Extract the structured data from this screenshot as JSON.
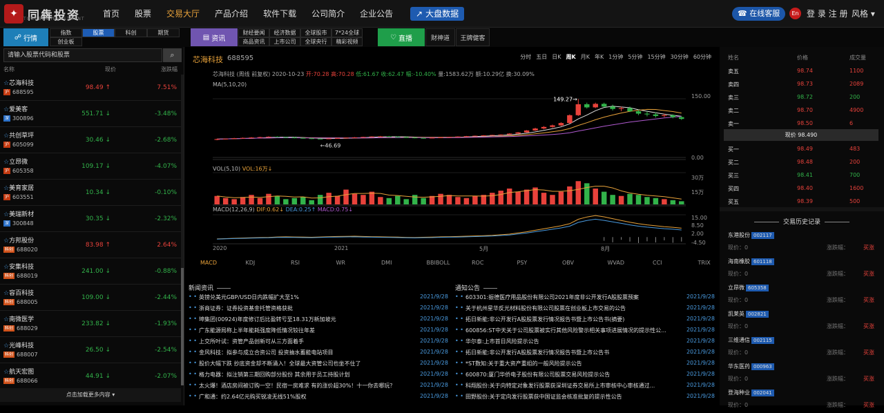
{
  "header": {
    "logo_text": "同犇投资",
    "logo_sub": "TONGBEN INVESTMENT",
    "nav": [
      "首页",
      "股票",
      "交易大厅",
      "产品介绍",
      "软件下载",
      "公司简介",
      "企业公告"
    ],
    "active_nav": "交易大厅",
    "bigdata_label": "大盘数据",
    "service_label": "在线客服",
    "lang": "En",
    "login": "登 录",
    "register": "注 册",
    "style": "风格"
  },
  "subbar": {
    "market_label": "行情",
    "market_tabs": [
      "指数",
      "股票",
      "科创",
      "期货",
      "创业板"
    ],
    "active_market": "股票",
    "news_label": "资讯",
    "news_tabs": [
      "财经要闻",
      "经济数据",
      "全球股市",
      "7*24全球",
      "商品资讯",
      "上市公司",
      "全球央行",
      "精彩视频"
    ],
    "live_label": "直播",
    "live_tabs": [
      "财神道",
      "王牌健客"
    ]
  },
  "left": {
    "search_placeholder": "请输入股票代码和股票",
    "cols": [
      "名称",
      "现价",
      "涨跌幅"
    ],
    "load_more": "点击加载更多内容",
    "stocks": [
      {
        "name": "芯海科技",
        "mk": "沪",
        "mkc": "hu",
        "code": "688595",
        "price": "98.49 ↑",
        "chg": "7.51%",
        "dir": "up"
      },
      {
        "name": "爱美客",
        "mk": "深",
        "mkc": "shen",
        "code": "300896",
        "price": "551.71 ↓",
        "chg": "-3.48%",
        "dir": "down"
      },
      {
        "name": "共创草坪",
        "mk": "沪",
        "mkc": "hu",
        "code": "605099",
        "price": "30.46 ↓",
        "chg": "-2.68%",
        "dir": "down"
      },
      {
        "name": "立昂微",
        "mk": "沪",
        "mkc": "hu",
        "code": "605358",
        "price": "109.17 ↓",
        "chg": "-4.07%",
        "dir": "down"
      },
      {
        "name": "美育家居",
        "mk": "沪",
        "mkc": "hu",
        "code": "603551",
        "price": "10.34 ↓",
        "chg": "-0.10%",
        "dir": "down"
      },
      {
        "name": "美瑞新材",
        "mk": "深",
        "mkc": "shen",
        "code": "300848",
        "price": "30.35 ↓",
        "chg": "-2.32%",
        "dir": "down"
      },
      {
        "name": "方邦股份",
        "mk": "科创",
        "mkc": "kc",
        "code": "688020",
        "price": "83.98 ↑",
        "chg": "2.64%",
        "dir": "up"
      },
      {
        "name": "安集科技",
        "mk": "科创",
        "mkc": "kc",
        "code": "688019",
        "price": "241.00 ↓",
        "chg": "-0.88%",
        "dir": "down"
      },
      {
        "name": "容百科技",
        "mk": "科创",
        "mkc": "kc",
        "code": "688005",
        "price": "109.00 ↓",
        "chg": "-2.44%",
        "dir": "down"
      },
      {
        "name": "南微医学",
        "mk": "科创",
        "mkc": "kc",
        "code": "688029",
        "price": "233.82 ↓",
        "chg": "-1.93%",
        "dir": "down"
      },
      {
        "name": "光峰科技",
        "mk": "科创",
        "mkc": "kc",
        "code": "688007",
        "price": "26.50 ↓",
        "chg": "-2.54%",
        "dir": "down"
      },
      {
        "name": "航天宏图",
        "mk": "科创",
        "mkc": "kc",
        "code": "688066",
        "price": "44.91 ↓",
        "chg": "-2.07%",
        "dir": "down"
      }
    ]
  },
  "chart": {
    "name": "芯海科技",
    "code": "688595",
    "periods": [
      "分时",
      "五日",
      "日K",
      "周K",
      "月K",
      "年K",
      "1分钟",
      "5分钟",
      "15分钟",
      "30分钟",
      "60分钟"
    ],
    "active_period": "周K",
    "info": {
      "base": "芯海科技 (周线 前复权) 2020-10-23",
      "open": "开:70.28",
      "high": "高:70.28",
      "low": "低:61.67",
      "close": "收:62.47",
      "chg": "幅:-10.40%",
      "amt": "量:1583.62万",
      "turn": "额:10.29亿",
      "rate": "换:30.09%"
    },
    "ma_label": "MA(5,10,20)",
    "hi_annot": "149.27→",
    "lo_annot": "←46.69",
    "price_axis": [
      "150.00",
      "0.00"
    ],
    "vol_label": "VOL(5,10)",
    "vol_val": "VOL:16万↓",
    "vol_axis": [
      "30万",
      "15万"
    ],
    "macd_label": "MACD(12,26,9)",
    "dif": "DIF:0.62↓",
    "dea": "DEA:0.25↑",
    "macd_val": "MACD:0.75↓",
    "macd_axis": [
      "15.00",
      "8.50",
      "2.00",
      "-4.50"
    ],
    "x_labels": [
      "2020",
      "2021",
      "5月",
      "8月"
    ],
    "indicators": [
      "MACD",
      "KDJ",
      "RSI",
      "WR",
      "DMI",
      "BBIBOLL",
      "ROC",
      "PSY",
      "OBV",
      "WVAD",
      "CCI",
      "TRIX"
    ],
    "active_indicator": "MACD",
    "ohlc": [
      [
        45,
        48,
        44,
        47
      ],
      [
        47,
        48,
        46,
        48
      ],
      [
        48,
        50,
        47,
        49
      ],
      [
        49,
        51,
        48,
        50
      ],
      [
        50,
        52,
        49,
        51
      ],
      [
        51,
        53,
        50,
        52
      ],
      [
        52,
        54,
        51,
        53
      ],
      [
        53,
        54,
        51,
        52
      ],
      [
        52,
        53,
        50,
        51
      ],
      [
        51,
        52,
        49,
        50
      ],
      [
        50,
        51,
        48,
        49
      ],
      [
        49,
        50,
        47,
        48
      ],
      [
        48,
        49,
        46.69,
        47.5
      ],
      [
        47.5,
        49,
        47,
        48.5
      ],
      [
        48.5,
        50,
        48,
        49.5
      ],
      [
        49.5,
        51,
        49,
        50.5
      ],
      [
        50.5,
        52,
        50,
        51.5
      ],
      [
        51.5,
        53,
        51,
        52.5
      ],
      [
        52.5,
        54,
        52,
        53.5
      ],
      [
        53.5,
        55,
        53,
        54
      ],
      [
        54,
        55,
        52,
        53
      ],
      [
        53,
        54,
        51,
        52
      ],
      [
        52,
        53,
        50,
        51
      ],
      [
        51,
        52,
        49,
        50
      ],
      [
        50,
        51,
        48,
        49.5
      ],
      [
        49.5,
        51,
        49,
        50.5
      ],
      [
        50.5,
        52,
        50,
        51.5
      ],
      [
        51.5,
        53,
        51,
        52.5
      ],
      [
        52.5,
        54,
        52,
        53.5
      ],
      [
        53.5,
        55,
        53,
        54.5
      ],
      [
        54.5,
        56,
        54,
        55.5
      ],
      [
        55.5,
        57,
        55,
        56.5
      ],
      [
        56.5,
        58,
        56,
        57.5
      ],
      [
        57.5,
        59,
        57,
        58.5
      ],
      [
        58.5,
        62,
        58,
        61
      ],
      [
        61,
        65,
        60,
        64
      ],
      [
        64,
        70,
        63,
        69
      ],
      [
        69,
        76,
        68,
        74
      ],
      [
        74,
        80,
        72,
        78
      ],
      [
        78,
        84,
        76,
        82
      ],
      [
        82,
        90,
        80,
        88
      ],
      [
        88,
        110,
        86,
        108
      ],
      [
        108,
        149.27,
        106,
        136
      ],
      [
        136,
        140,
        125,
        128
      ],
      [
        128,
        140,
        126,
        137
      ],
      [
        137,
        140,
        128,
        130
      ],
      [
        130,
        135,
        120,
        124
      ],
      [
        124,
        130,
        118,
        126
      ],
      [
        126,
        130,
        116,
        118
      ],
      [
        118,
        122,
        108,
        112
      ],
      [
        112,
        118,
        105,
        110
      ],
      [
        110,
        115,
        102,
        106
      ],
      [
        106,
        112,
        103,
        108
      ],
      [
        108,
        110,
        100,
        103
      ],
      [
        103,
        106,
        96,
        98.49
      ]
    ],
    "vol": [
      8,
      6,
      5,
      7,
      9,
      6,
      10,
      8,
      5,
      6,
      7,
      4,
      9,
      11,
      8,
      14,
      10,
      9,
      12,
      7,
      6,
      8,
      5,
      9,
      6,
      8,
      10,
      9,
      7,
      6,
      8,
      9,
      11,
      13,
      15,
      12,
      14,
      16,
      11,
      9,
      12,
      17,
      22,
      20,
      15,
      12,
      9,
      8,
      10,
      9,
      7,
      6,
      5,
      4,
      3
    ],
    "macd": [
      -1.2,
      -1.0,
      -0.8,
      -0.6,
      -0.4,
      -0.3,
      -0.2,
      0.1,
      0.2,
      0.1,
      0.0,
      -0.1,
      0.1,
      0.3,
      0.4,
      0.5,
      0.6,
      0.4,
      0.3,
      0.2,
      0.1,
      0.0,
      -0.2,
      -0.3,
      -0.1,
      0.0,
      0.2,
      0.3,
      0.4,
      0.6,
      0.8,
      1.0,
      1.2,
      1.6,
      2.0,
      2.8,
      3.6,
      4.6,
      5.6,
      6.6,
      7.6,
      9.0,
      12.0,
      13.5,
      14.5,
      13.6,
      12.4,
      11.2,
      10.0,
      9.0,
      8.2,
      7.6,
      7.0,
      6.6,
      6.0
    ],
    "macd_hist": [
      0,
      0,
      0,
      0,
      0,
      0,
      0,
      0,
      0,
      0,
      0,
      0,
      0,
      0,
      0,
      0,
      0,
      0,
      0,
      0,
      0,
      0,
      0,
      0,
      0,
      0,
      0,
      0,
      0,
      0,
      0,
      0,
      0,
      0,
      0,
      0,
      0,
      0,
      0,
      0,
      0,
      0,
      0,
      0,
      0,
      -2.5,
      -3.5,
      -1.8,
      -3.0,
      -4.0,
      -2.8,
      -3.6,
      -2.2,
      -3.8,
      -3.0
    ]
  },
  "news": {
    "title": "新闻资讯",
    "items": [
      {
        "t": "英镑兑美元GBP/USD日内跌幅扩大至1%",
        "d": "2021/9/28"
      },
      {
        "t": "浙商证券：证券投资基金托管资格获批",
        "d": "2021/9/28"
      },
      {
        "t": "坤集团(00924)年度修订后比盈转亏至18.31万新加坡元",
        "d": "2021/9/28"
      },
      {
        "t": "广东能源局称上半年能耗强度降低情况较往年差",
        "d": "2021/9/28"
      },
      {
        "t": "上交所叶试：资管产品创新可从三方面着手",
        "d": "2021/9/28"
      },
      {
        "t": "金风科技：拟参与成立合资公司 投资抽水蓄能电站项目",
        "d": "2021/9/28"
      },
      {
        "t": "股价大幅下跌 抄底资金却不断涌入！全球最大资管公司也坐不住了",
        "d": "2021/9/28"
      },
      {
        "t": "格力电器：拟注销第三期回购部分股份 其余用于员工持股计划",
        "d": "2021/9/28"
      },
      {
        "t": "太火爆！酒店房间被订购一空！民宿一房难求 有的涨价超30%！十一你去哪玩？",
        "d": "2021/9/28"
      },
      {
        "t": "广和通：约2.64亿元购买锐凌无线51%股权",
        "d": "2021/9/28"
      }
    ]
  },
  "notice": {
    "title": "通知公告",
    "items": [
      {
        "t": "603301:振德医疗用品股份有限公司2021年度非公开发行A股股票预案",
        "d": "2021/9/28"
      },
      {
        "t": "关于杭州星华反光材料股份有限公司股票在创业板上市交易的公告",
        "d": "2021/9/28"
      },
      {
        "t": "拓日新能:非公开发行A股股票发行情况报告书暨上市公告书(摘要)",
        "d": "2021/9/28"
      },
      {
        "t": "600856:ST中天关于公司股票被实行其他风险警示相关事项进展情况的提示性公...",
        "d": "2021/9/28"
      },
      {
        "t": "华尔泰:上市首日风险提示公告",
        "d": "2021/9/28"
      },
      {
        "t": "拓日新能:非公开发行A股股票发行情况报告书暨上市公告书",
        "d": "2021/9/28"
      },
      {
        "t": "*ST数知:关于重大资产重组的一般风险提示公告",
        "d": "2021/9/28"
      },
      {
        "t": "600870:厦门华侨电子股份有限公司股票交易风险提示公告",
        "d": "2021/9/28"
      },
      {
        "t": "科翔股份:关于向特定对象发行股票获深圳证券交易所上市审核中心审核通过...",
        "d": "2021/9/28"
      },
      {
        "t": "田野股份:关于定向发行股票获中国证监会核准批复的提示性公告",
        "d": "2021/9/28"
      }
    ]
  },
  "orderbook": {
    "cols": [
      "姓名",
      "价格",
      "成交量"
    ],
    "sells": [
      {
        "l": "卖五",
        "p": "98.74",
        "v": "1100"
      },
      {
        "l": "卖四",
        "p": "98.73",
        "v": "2089"
      },
      {
        "l": "卖三",
        "p": "98.72",
        "v": "200"
      },
      {
        "l": "卖二",
        "p": "98.70",
        "v": "4900"
      },
      {
        "l": "卖一",
        "p": "98.50",
        "v": "6"
      }
    ],
    "current": "现价 98.490",
    "buys": [
      {
        "l": "买一",
        "p": "98.49",
        "v": "483"
      },
      {
        "l": "买二",
        "p": "98.48",
        "v": "200"
      },
      {
        "l": "买三",
        "p": "98.41",
        "v": "700"
      },
      {
        "l": "买四",
        "p": "98.40",
        "v": "1600"
      },
      {
        "l": "买五",
        "p": "98.39",
        "v": "500"
      }
    ]
  },
  "history": {
    "title": "交易历史记录",
    "price_label": "现价：0",
    "chg_label": "涨跌幅：",
    "buy_label": "买涨",
    "items": [
      {
        "n": "东港股份",
        "c": "002117"
      },
      {
        "n": "海南橡胶",
        "c": "601118"
      },
      {
        "n": "立昂微",
        "c": "605358"
      },
      {
        "n": "凯莱英",
        "c": "002821"
      },
      {
        "n": "三维通信",
        "c": "002115"
      },
      {
        "n": "华东医药",
        "c": "000963"
      },
      {
        "n": "登海种业",
        "c": "002041"
      }
    ]
  },
  "colors": {
    "up": "#e8423b",
    "down": "#32b34a",
    "accent": "#e8a23a",
    "blue": "#1e5bb0"
  }
}
